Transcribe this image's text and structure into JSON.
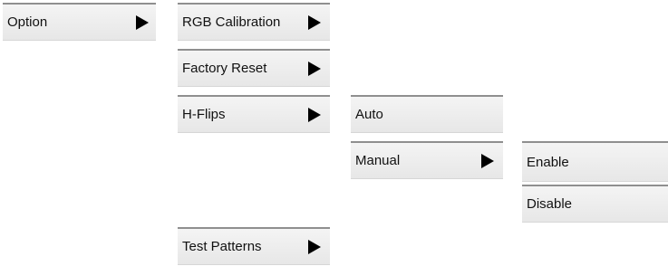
{
  "menu": {
    "option": "Option",
    "option_submenu": {
      "rgb_calibration": "RGB Calibration",
      "factory_reset": "Factory Reset",
      "h_flips": "H-Flips",
      "test_patterns": "Test Patterns"
    },
    "h_flips_submenu": {
      "auto": "Auto",
      "manual": "Manual"
    },
    "manual_submenu": {
      "enable": "Enable",
      "disable": "Disable"
    }
  },
  "icons": {
    "submenu_arrow": "triangle-right-icon"
  },
  "colors": {
    "item_background": "#ececec",
    "item_top_border": "#8f8f8f",
    "text": "#111111",
    "arrow": "#000000"
  }
}
